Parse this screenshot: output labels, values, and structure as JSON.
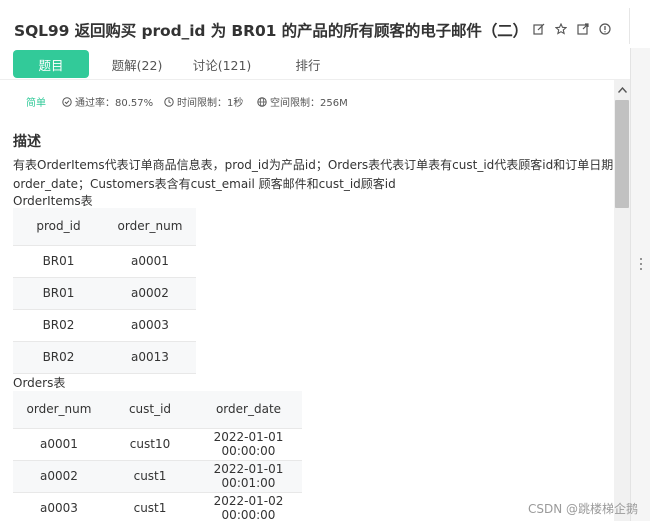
{
  "header": {
    "title": "SQL99  返回购买 prod_id 为 BR01 的产品的所有顾客的电子邮件（二）",
    "icons": [
      "edit-icon",
      "star-icon",
      "external-link-icon",
      "info-icon"
    ]
  },
  "tabs": [
    {
      "label": "题目",
      "active": true
    },
    {
      "label": "题解(22)",
      "active": false
    },
    {
      "label": "讨论(121)",
      "active": false
    },
    {
      "label": "排行",
      "active": false
    }
  ],
  "meta": {
    "difficulty": "简单",
    "pass_rate": "通过率：80.57%",
    "time_limit": "时间限制：1秒",
    "space_limit": "空间限制：256M"
  },
  "content": {
    "section_title": "描述",
    "desc_line1": "有表OrderItems代表订单商品信息表，prod_id为产品id；Orders表代表订单表有cust_id代表顾客id和订单日期",
    "desc_line2": "order_date；Customers表含有cust_email 顾客邮件和cust_id顾客id",
    "orderitems_label": "OrderItems表",
    "orderitems": {
      "headers": [
        "prod_id",
        "order_num"
      ],
      "rows": [
        [
          "BR01",
          "a0001"
        ],
        [
          "BR01",
          "a0002"
        ],
        [
          "BR02",
          "a0003"
        ],
        [
          "BR02",
          "a0013"
        ]
      ]
    },
    "orders_label": "Orders表",
    "orders": {
      "headers": [
        "order_num",
        "cust_id",
        "order_date"
      ],
      "rows": [
        [
          "a0001",
          "cust10",
          "2022-01-01 00:00:00"
        ],
        [
          "a0002",
          "cust1",
          "2022-01-01 00:01:00"
        ],
        [
          "a0003",
          "cust1",
          "2022-01-02 00:00:00"
        ]
      ]
    }
  },
  "watermark": "CSDN @跳楼梯企鹅",
  "colors": {
    "accent": "#32ca99",
    "text": "#333333"
  }
}
